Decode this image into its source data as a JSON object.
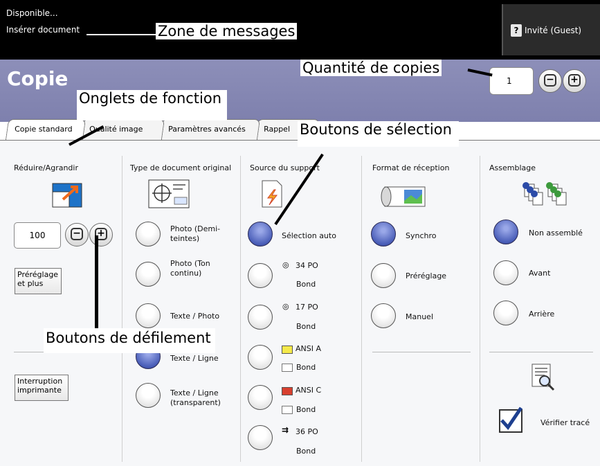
{
  "topbar": {
    "status": "Disponible...",
    "prompt": "Insérer document",
    "guest_icon": "?",
    "guest_label": "Invité (Guest)"
  },
  "header": {
    "title": "Copie",
    "quantity": "1",
    "minus": "−",
    "plus": "+"
  },
  "tabs": [
    "Copie standard",
    "Qualité image",
    "Paramètres avancés",
    "Rappel"
  ],
  "reduce": {
    "header": "Réduire/Agrandir",
    "value": "100",
    "minus": "−",
    "plus": "+",
    "preset_label": "Préréglage et plus",
    "interrupt_label": "Interruption imprimante"
  },
  "doc_type": {
    "header": "Type de document original",
    "options": [
      "Photo (Demi-teintes)",
      "Photo (Ton continu)",
      "Texte / Photo",
      "Texte / Ligne",
      "Texte / Ligne (transparent)"
    ],
    "selected_index": 3
  },
  "paper_source": {
    "header": "Source du support",
    "options": [
      {
        "line1": "Sélection auto",
        "line2": ""
      },
      {
        "line1": "34 PO",
        "line2": "Bond"
      },
      {
        "line1": "17 PO",
        "line2": "Bond"
      },
      {
        "line1": "ANSI A",
        "line2": "Bond"
      },
      {
        "line1": "ANSI C",
        "line2": "Bond"
      },
      {
        "line1": "36 PO",
        "line2": "Bond"
      }
    ],
    "selected_index": 0
  },
  "output_format": {
    "header": "Format de réception",
    "options": [
      "Synchro",
      "Préréglage",
      "Manuel"
    ],
    "selected_index": 0
  },
  "collation": {
    "header": "Assemblage",
    "options": [
      "Non assemblé",
      "Avant",
      "Arrière"
    ],
    "selected_index": 0,
    "verify_label": "Vérifier tracé"
  },
  "callouts": {
    "messages": "Zone de messages",
    "quantity": "Quantité de copies",
    "tabs": "Onglets de fonction",
    "selection": "Boutons de sélection",
    "scroll": "Boutons de défilement"
  }
}
